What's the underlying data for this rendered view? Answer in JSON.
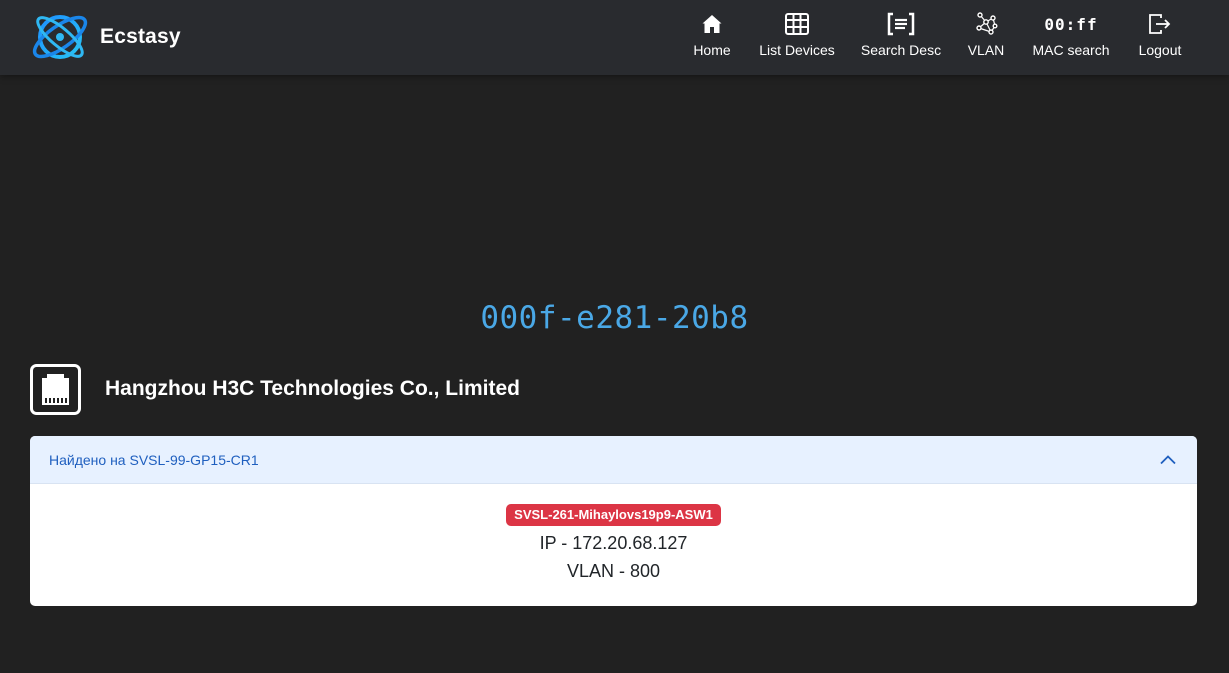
{
  "app": {
    "brand": "Ecstasy"
  },
  "nav": {
    "items": [
      {
        "id": "home",
        "label": "Home",
        "icon": "house-icon"
      },
      {
        "id": "list-devices",
        "label": "List Devices",
        "icon": "table-grid-icon"
      },
      {
        "id": "search-desc",
        "label": "Search Desc",
        "icon": "text-search-icon"
      },
      {
        "id": "vlan",
        "label": "VLAN",
        "icon": "network-nodes-icon"
      },
      {
        "id": "mac-search",
        "label": "MAC search",
        "icon_text": "00:ff"
      },
      {
        "id": "logout",
        "label": "Logout",
        "icon": "logout-icon"
      }
    ]
  },
  "main": {
    "mac_address": "000f-e281-20b8",
    "vendor": "Hangzhou H3C Technologies Co., Limited",
    "vendor_icon": "ethernet-port-icon"
  },
  "result": {
    "header": "Найдено на SVSL-99-GP15-CR1",
    "expanded": true,
    "device_name": "SVSL-261-Mihaylovs19p9-ASW1",
    "ip_line": "IP - 172.20.68.127",
    "vlan_line": "VLAN - 800"
  },
  "colors": {
    "background": "#212121",
    "navbar": "#292b2f",
    "mac_title": "#4aa8e6",
    "badge": "#dc3545",
    "accordion_header_bg": "#e7f1ff",
    "accordion_header_text": "#1f5fbf"
  }
}
